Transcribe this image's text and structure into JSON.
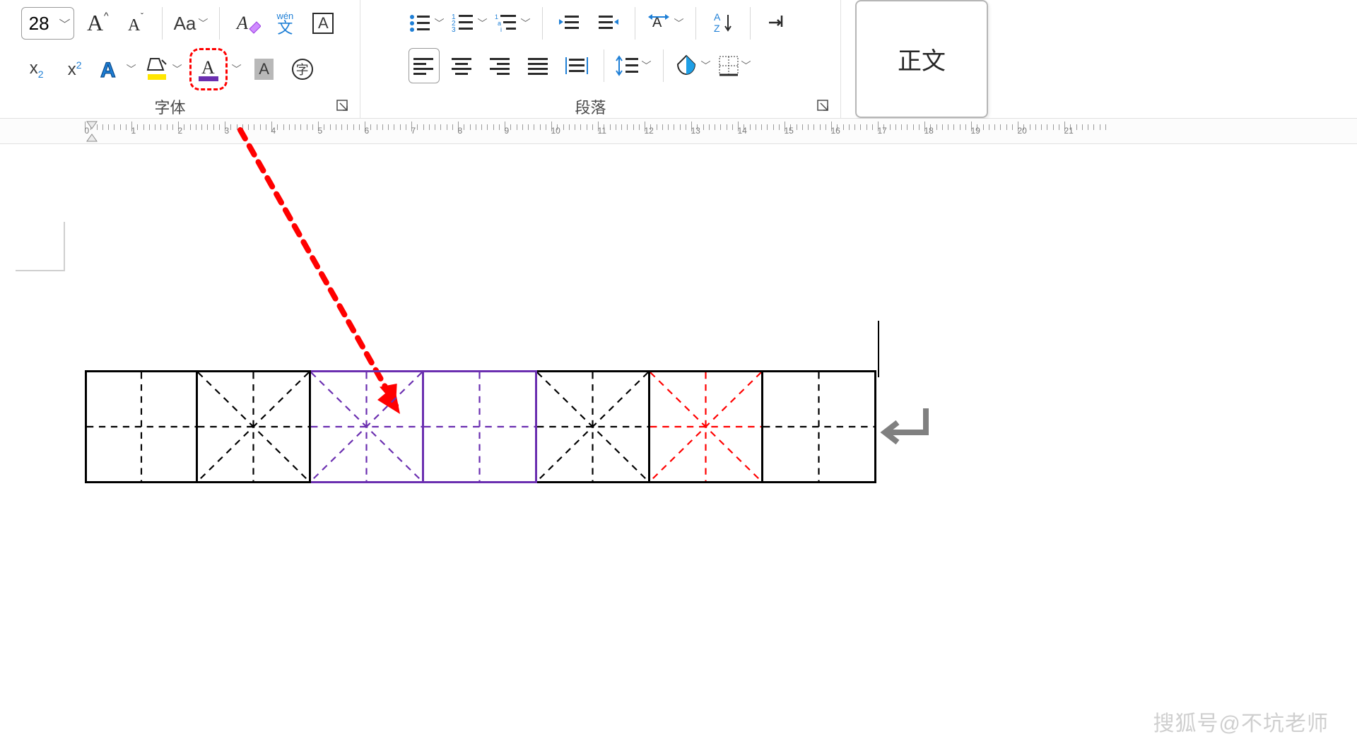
{
  "ribbon": {
    "font_size_value": "28",
    "grow_font": "A",
    "shrink_font": "A",
    "change_case": "Aa",
    "phonetic_top": "wén",
    "phonetic_char": "文",
    "font_box_char": "A",
    "subscript": "x",
    "subscript_sub": "2",
    "superscript": "x",
    "superscript_sup": "2",
    "text_effect": "A",
    "font_color_letter": "A",
    "char_shading": "A",
    "char_circle": "字",
    "group_font_label": "字体",
    "group_paragraph_label": "段落"
  },
  "styles": {
    "body_style": "正文"
  },
  "watermark": "搜狐号@不坑老师",
  "cells": [
    {
      "border": "black",
      "diag": false,
      "diag_color": "#000000"
    },
    {
      "border": "black",
      "diag": true,
      "diag_color": "#000000"
    },
    {
      "border": "purple",
      "diag": true,
      "diag_color": "#6b2fb0"
    },
    {
      "border": "purple",
      "diag": false,
      "diag_color": "#6b2fb0"
    },
    {
      "border": "black",
      "diag": true,
      "diag_color": "#000000"
    },
    {
      "border": "black",
      "diag": true,
      "diag_color": "#ff0000"
    },
    {
      "border": "black",
      "diag": false,
      "diag_color": "#000000"
    }
  ]
}
